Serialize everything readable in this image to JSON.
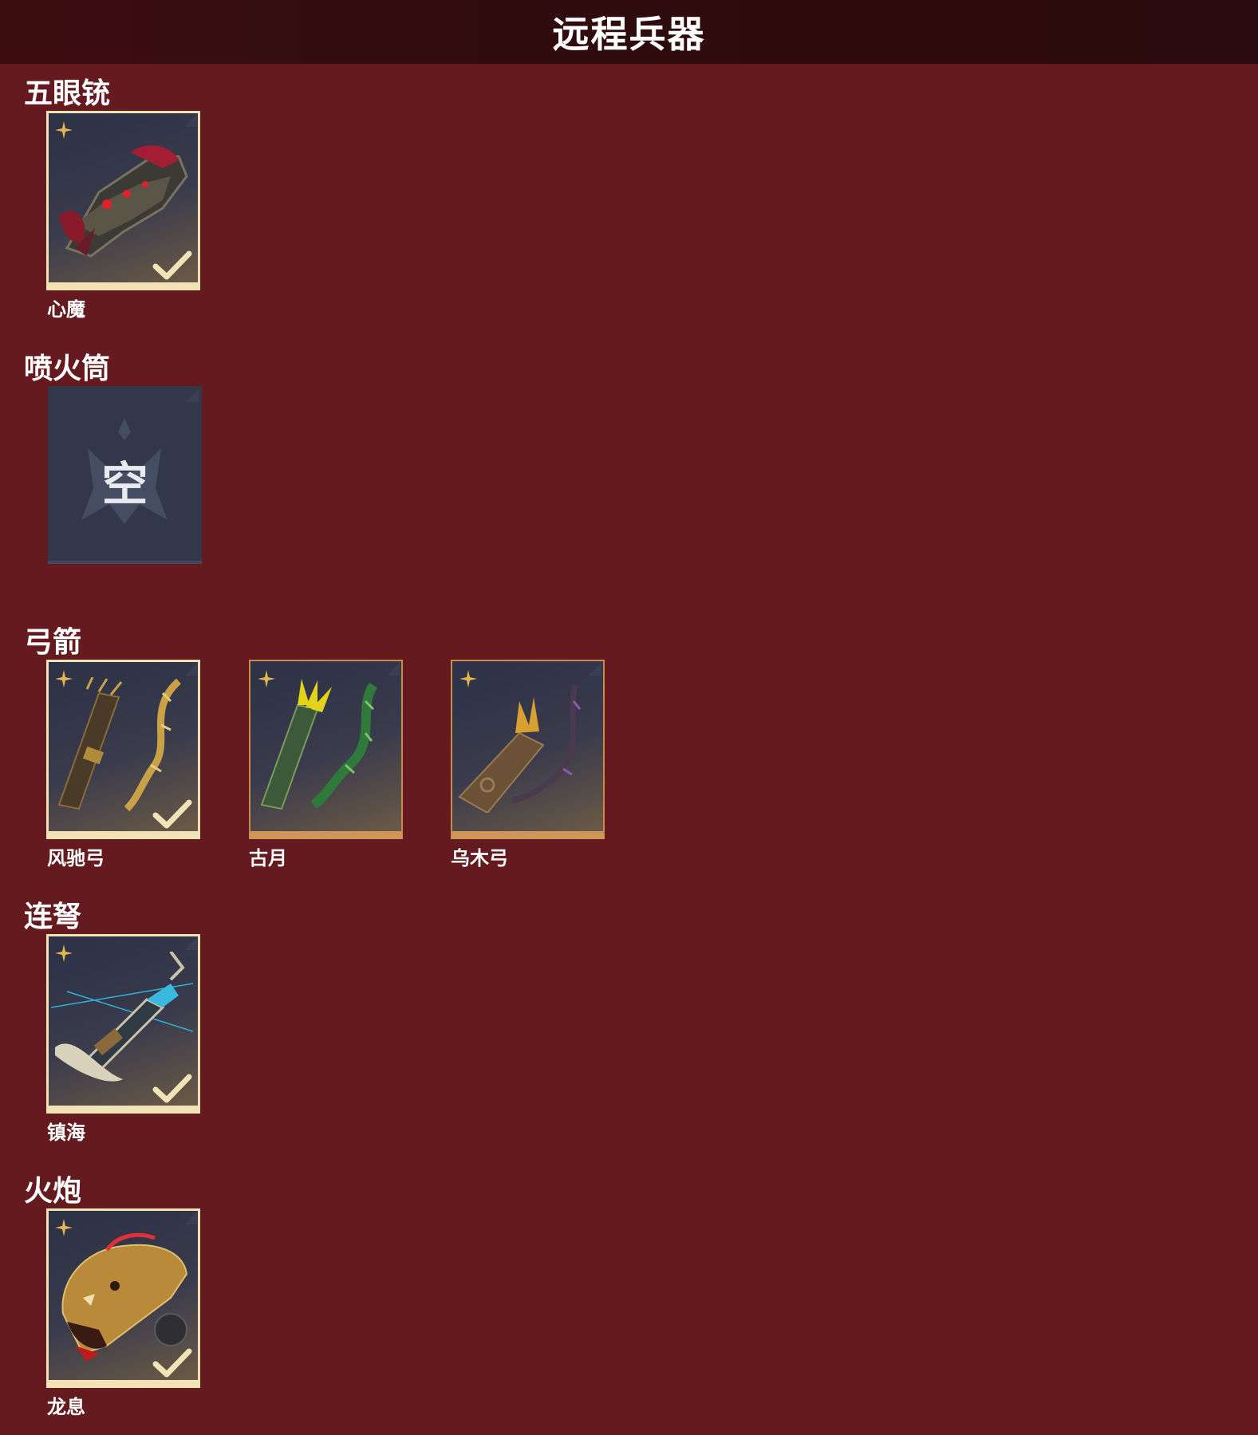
{
  "header": {
    "title": "远程兵器"
  },
  "sections": [
    {
      "title": "五眼铳",
      "items": [
        {
          "name": "心魔",
          "state": "equipped",
          "art": "demon-gun"
        }
      ]
    },
    {
      "title": "喷火筒",
      "items": [
        {
          "name": "",
          "state": "empty",
          "placeholder": "空"
        }
      ]
    },
    {
      "title": "弓箭",
      "items": [
        {
          "name": "风驰弓",
          "state": "equipped",
          "art": "golden-bow"
        },
        {
          "name": "古月",
          "state": "owned",
          "art": "green-bow"
        },
        {
          "name": "乌木弓",
          "state": "owned",
          "art": "wood-bow"
        }
      ]
    },
    {
      "title": "连弩",
      "items": [
        {
          "name": "镇海",
          "state": "equipped",
          "art": "crossbow"
        }
      ]
    },
    {
      "title": "火炮",
      "items": [
        {
          "name": "龙息",
          "state": "equipped",
          "art": "dragon-cannon"
        }
      ]
    }
  ],
  "colors": {
    "background": "#651a1f",
    "header": "#2e0b0d",
    "card_border_equipped": "#f2e3b6",
    "card_border_owned": "#d09558",
    "empty_card": "#323849",
    "rarity_star": "#e5b54e"
  },
  "icons": {
    "rarity": "four-point-star-icon",
    "equipped": "checkmark-icon",
    "empty": "empty-slot-emblem-icon"
  }
}
